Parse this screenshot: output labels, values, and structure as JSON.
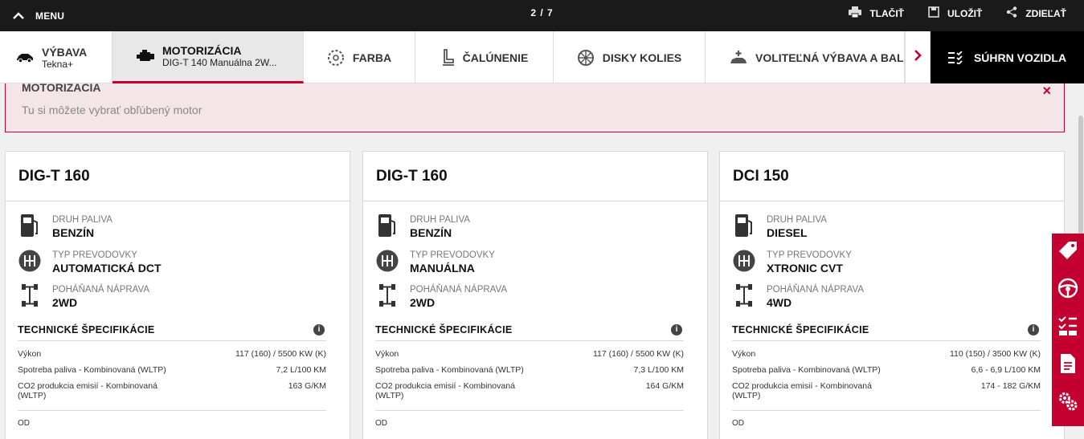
{
  "topbar": {
    "menu_label": "MENU",
    "step": "2 / 7",
    "actions": {
      "print": "TLAČIŤ",
      "save": "ULOŽIŤ",
      "share": "ZDIEĽAŤ"
    }
  },
  "tabs": {
    "vybava": {
      "label": "VÝBAVA",
      "sub": "Tekna+"
    },
    "motor": {
      "label": "MOTORIZÁCIA",
      "sub": "DIG-T 140 Manuálna 2W..."
    },
    "farba": {
      "label": "FARBA"
    },
    "calunenie": {
      "label": "ČALÚNENIE"
    },
    "disky": {
      "label": "DISKY KOLIES"
    },
    "volitelna": {
      "label": "VOLITEĽNÁ VÝBAVA A BALÍK"
    },
    "summary": {
      "label": "SÚHRN VOZIDLA"
    }
  },
  "banner": {
    "title": "MOTORIZÁCIA",
    "text": "Tu si môžete vybrať obľúbený motor",
    "close": "×"
  },
  "labels": {
    "fuel": "DRUH PALIVA",
    "gear": "TYP PREVODOVKY",
    "drive": "POHÁŇANÁ NÁPRAVA",
    "tech": "TECHNICKÉ ŠPECIFIKÁCIE",
    "power": "Výkon",
    "consumption": "Spotreba paliva - Kombinovaná (WLTP)",
    "co2": "CO2 produkcia emisií - Kombinovaná (WLTP)",
    "more": "OD"
  },
  "cards": [
    {
      "title": "DIG-T 160",
      "fuel": "BENZÍN",
      "gear": "AUTOMATICKÁ DCT",
      "drive": "2WD",
      "power": "117 (160) / 5500 KW (K)",
      "consumption": "7,2 L/100 KM",
      "co2": "163 G/KM"
    },
    {
      "title": "DIG-T 160",
      "fuel": "BENZÍN",
      "gear": "MANUÁLNA",
      "drive": "2WD",
      "power": "117 (160) / 5500 KW (K)",
      "consumption": "7,3 L/100 KM",
      "co2": "164 G/KM"
    },
    {
      "title": "DCI 150",
      "fuel": "DIESEL",
      "gear": "XTRONIC CVT",
      "drive": "4WD",
      "power": "110 (150) / 3500 KW (K)",
      "consumption": "6,6 - 6,9 L/100 KM",
      "co2": "174 - 182 G/KM"
    }
  ],
  "colors": {
    "accent": "#c3002f",
    "dark": "#1a1a1a"
  }
}
